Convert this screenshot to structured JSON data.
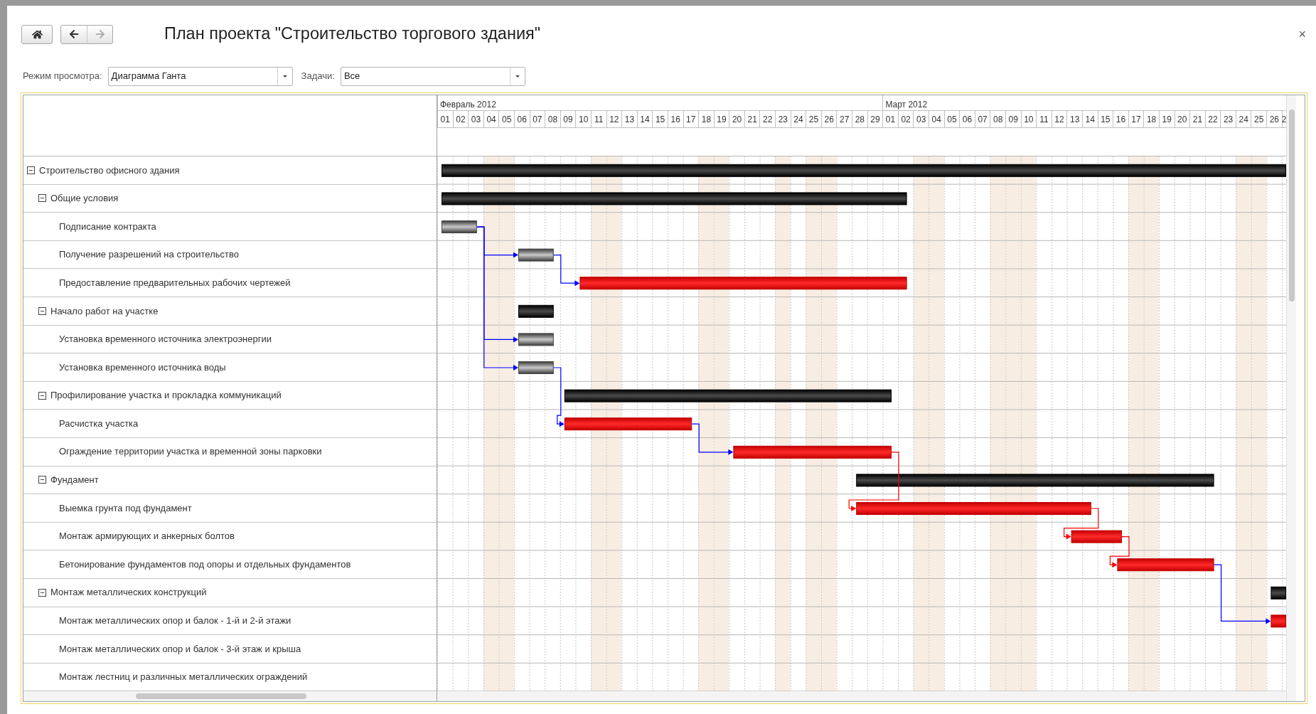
{
  "window": {
    "title": "План проекта \"Строительство торгового здания\"",
    "close": "×"
  },
  "nav": [
    {
      "kind": "home",
      "disabled": false
    },
    {
      "kind": "back",
      "disabled": false
    },
    {
      "kind": "forward",
      "disabled": true
    }
  ],
  "filters": [
    {
      "label": "Режим просмотра:",
      "value": "Диаграмма Ганта"
    },
    {
      "label": "Задачи:",
      "value": "Все"
    }
  ],
  "months": [
    {
      "label": "Февраль 2012",
      "days": [
        {
          "label": "01",
          "weekend": false
        },
        {
          "label": "02",
          "weekend": false
        },
        {
          "label": "03",
          "weekend": false
        },
        {
          "label": "04",
          "weekend": true
        },
        {
          "label": "05",
          "weekend": true
        },
        {
          "label": "06",
          "weekend": false
        },
        {
          "label": "07",
          "weekend": false
        },
        {
          "label": "08",
          "weekend": false
        },
        {
          "label": "09",
          "weekend": false
        },
        {
          "label": "10",
          "weekend": false
        },
        {
          "label": "11",
          "weekend": true
        },
        {
          "label": "12",
          "weekend": true
        },
        {
          "label": "13",
          "weekend": false
        },
        {
          "label": "14",
          "weekend": false
        },
        {
          "label": "15",
          "weekend": false
        },
        {
          "label": "16",
          "weekend": false
        },
        {
          "label": "17",
          "weekend": false
        },
        {
          "label": "18",
          "weekend": true
        },
        {
          "label": "19",
          "weekend": true
        },
        {
          "label": "20",
          "weekend": false
        },
        {
          "label": "21",
          "weekend": false
        },
        {
          "label": "22",
          "weekend": false
        },
        {
          "label": "23",
          "weekend": true
        },
        {
          "label": "24",
          "weekend": false
        },
        {
          "label": "25",
          "weekend": true
        },
        {
          "label": "26",
          "weekend": true
        },
        {
          "label": "27",
          "weekend": false
        },
        {
          "label": "28",
          "weekend": false
        },
        {
          "label": "29",
          "weekend": false
        }
      ]
    },
    {
      "label": "Март 2012",
      "days": [
        {
          "label": "01",
          "weekend": false
        },
        {
          "label": "02",
          "weekend": false
        },
        {
          "label": "03",
          "weekend": true
        },
        {
          "label": "04",
          "weekend": true
        },
        {
          "label": "05",
          "weekend": false
        },
        {
          "label": "06",
          "weekend": false
        },
        {
          "label": "07",
          "weekend": false
        },
        {
          "label": "08",
          "weekend": true
        },
        {
          "label": "09",
          "weekend": true
        },
        {
          "label": "10",
          "weekend": true
        },
        {
          "label": "11",
          "weekend": false
        },
        {
          "label": "12",
          "weekend": false
        },
        {
          "label": "13",
          "weekend": false
        },
        {
          "label": "14",
          "weekend": false
        },
        {
          "label": "15",
          "weekend": false
        },
        {
          "label": "16",
          "weekend": false
        },
        {
          "label": "17",
          "weekend": true
        },
        {
          "label": "18",
          "weekend": true
        },
        {
          "label": "19",
          "weekend": false
        },
        {
          "label": "20",
          "weekend": false
        },
        {
          "label": "21",
          "weekend": false
        },
        {
          "label": "22",
          "weekend": false
        },
        {
          "label": "23",
          "weekend": false
        },
        {
          "label": "24",
          "weekend": true
        },
        {
          "label": "25",
          "weekend": true
        },
        {
          "label": "26",
          "weekend": false
        },
        {
          "label": "2",
          "weekend": false
        }
      ]
    }
  ],
  "tasks": [
    {
      "name": "Строительство офисного здания",
      "kind": "summary",
      "expanded": true,
      "children": [
        {
          "name": "Общие условия",
          "kind": "summary",
          "expanded": true,
          "children": [
            {
              "name": "Подписание контракта",
              "kind": "task",
              "critical": false
            },
            {
              "name": "Получение разрешений на строительство",
              "kind": "task",
              "critical": false
            },
            {
              "name": "Предоставление предварительных рабочих чертежей",
              "kind": "task",
              "critical": true
            }
          ]
        },
        {
          "name": "Начало работ на участке",
          "kind": "summary",
          "expanded": true,
          "children": [
            {
              "name": "Установка временного источника электроэнергии",
              "kind": "task",
              "critical": false
            },
            {
              "name": "Установка временного источника воды",
              "kind": "task",
              "critical": false
            }
          ]
        },
        {
          "name": "Профилирование участка и прокладка коммуникаций",
          "kind": "summary",
          "expanded": true,
          "children": [
            {
              "name": "Расчистка участка",
              "kind": "task",
              "critical": true
            },
            {
              "name": "Ограждение территории участка и временной зоны парковки",
              "kind": "task",
              "critical": true
            }
          ]
        },
        {
          "name": "Фундамент",
          "kind": "summary",
          "expanded": true,
          "children": [
            {
              "name": "Выемка грунта под фундамент",
              "kind": "task",
              "critical": true
            },
            {
              "name": "Монтаж армирующих и анкерных болтов",
              "kind": "task",
              "critical": true
            },
            {
              "name": "Бетонирование фундаментов под опоры и отдельных фундаментов",
              "kind": "task",
              "critical": true
            }
          ]
        },
        {
          "name": "Монтаж металлических конструкций",
          "kind": "summary",
          "expanded": true,
          "children": [
            {
              "name": "Монтаж металлических опор и балок - 1-й и 2-й этажи",
              "kind": "task",
              "critical": true
            },
            {
              "name": "Монтаж металлических опор и балок - 3-й этаж и крыша",
              "kind": "task"
            },
            {
              "name": "Монтаж лестниц и различных металлических ограждений",
              "kind": "task"
            }
          ]
        }
      ]
    }
  ]
}
